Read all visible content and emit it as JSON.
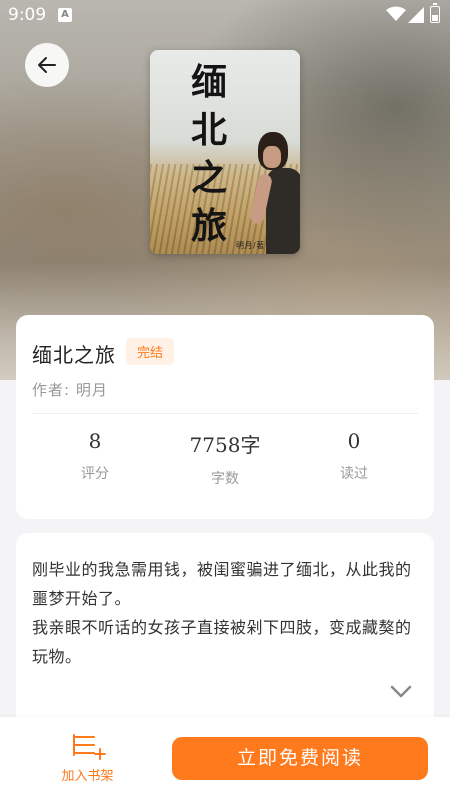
{
  "status_bar": {
    "time": "9:09",
    "notification_icon": "A"
  },
  "back_icon": "arrow-left-icon",
  "cover": {
    "title": "缅北之旅",
    "author": "明月/著"
  },
  "book": {
    "title": "缅北之旅",
    "status": "完结",
    "author_line": "作者: 明月"
  },
  "stats": [
    {
      "value": "8",
      "label": "评分"
    },
    {
      "value": "7758字",
      "label": "字数"
    },
    {
      "value": "0",
      "label": "读过"
    }
  ],
  "description": {
    "paragraphs": [
      "刚毕业的我急需用钱，被闺蜜骗进了缅北，从此我的噩梦开始了。",
      "我亲眼不听话的女孩子直接被剁下四肢，变成藏獒的玩物。"
    ],
    "expand_icon": "chevron-down-icon"
  },
  "bottom_bar": {
    "shelf_label": "加入书架",
    "read_label": "立即免费阅读"
  },
  "colors": {
    "accent": "#ff7a1c",
    "badge_bg": "#fff1e6"
  }
}
